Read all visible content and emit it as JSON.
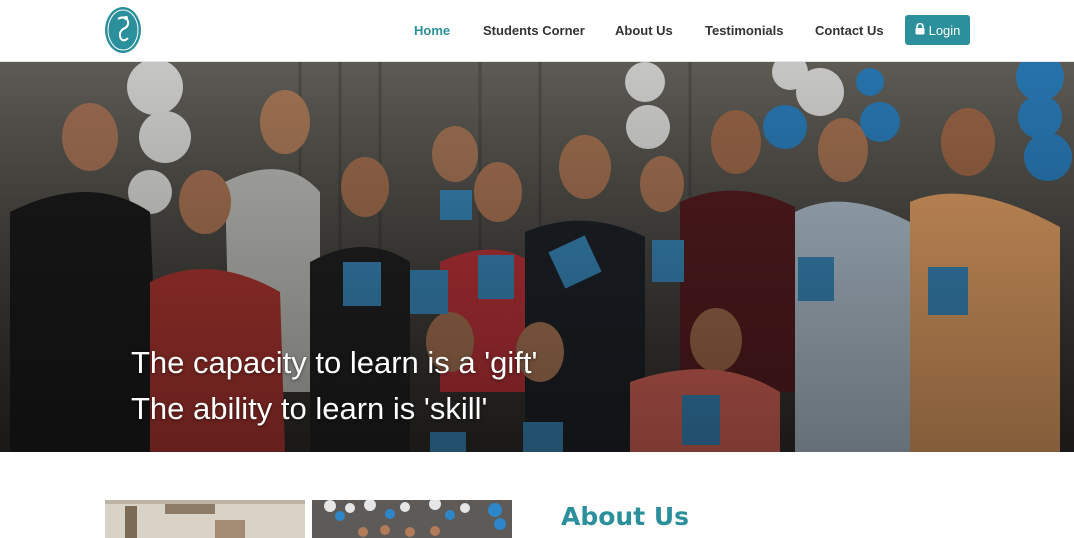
{
  "nav": {
    "links": [
      {
        "label": "Home",
        "active": true
      },
      {
        "label": "Students Corner",
        "active": false
      },
      {
        "label": "About Us",
        "active": false
      },
      {
        "label": "Testimonials",
        "active": false
      },
      {
        "label": "Contact Us",
        "active": false
      }
    ],
    "login_label": "Login",
    "login_icon": "lock-icon"
  },
  "hero": {
    "line1": "The capacity to learn is a 'gift'",
    "line2": "The ability to learn is 'skill'"
  },
  "about": {
    "title": "About Us"
  },
  "colors": {
    "accent": "#2b8f9c",
    "nav_text": "#333333",
    "hero_text": "#ffffff"
  }
}
